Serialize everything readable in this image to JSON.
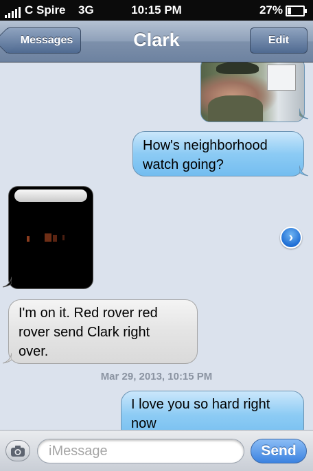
{
  "status_bar": {
    "carrier": "C Spire",
    "network": "3G",
    "time": "10:15 PM",
    "battery_percent": "27%",
    "battery_level": 0.27
  },
  "nav": {
    "back_label": "Messages",
    "title": "Clark",
    "edit_label": "Edit"
  },
  "messages": [
    {
      "direction": "outgoing",
      "type": "image"
    },
    {
      "direction": "outgoing",
      "type": "text",
      "lines": [
        "How's neighborhood",
        "watch going?"
      ]
    },
    {
      "direction": "incoming",
      "type": "image"
    },
    {
      "direction": "incoming",
      "type": "text",
      "lines": [
        "I'm on it.  Red rover red",
        "rover send Clark right",
        "over."
      ]
    },
    {
      "direction": "outgoing",
      "type": "text",
      "lines": [
        "I love you so hard right",
        "now"
      ]
    }
  ],
  "timestamp": "Mar 29, 2013, 10:15 PM",
  "input": {
    "placeholder": "iMessage",
    "value": "",
    "send_label": "Send"
  },
  "icons": {
    "camera": "camera-icon",
    "forward": "chevron-right-icon",
    "back": "back-arrow-icon"
  },
  "colors": {
    "outgoing_bubble": "#8ccbf4",
    "incoming_bubble": "#e4e4e4",
    "nav_bar": "#8ea0b9",
    "send_button": "#3b82e0"
  }
}
